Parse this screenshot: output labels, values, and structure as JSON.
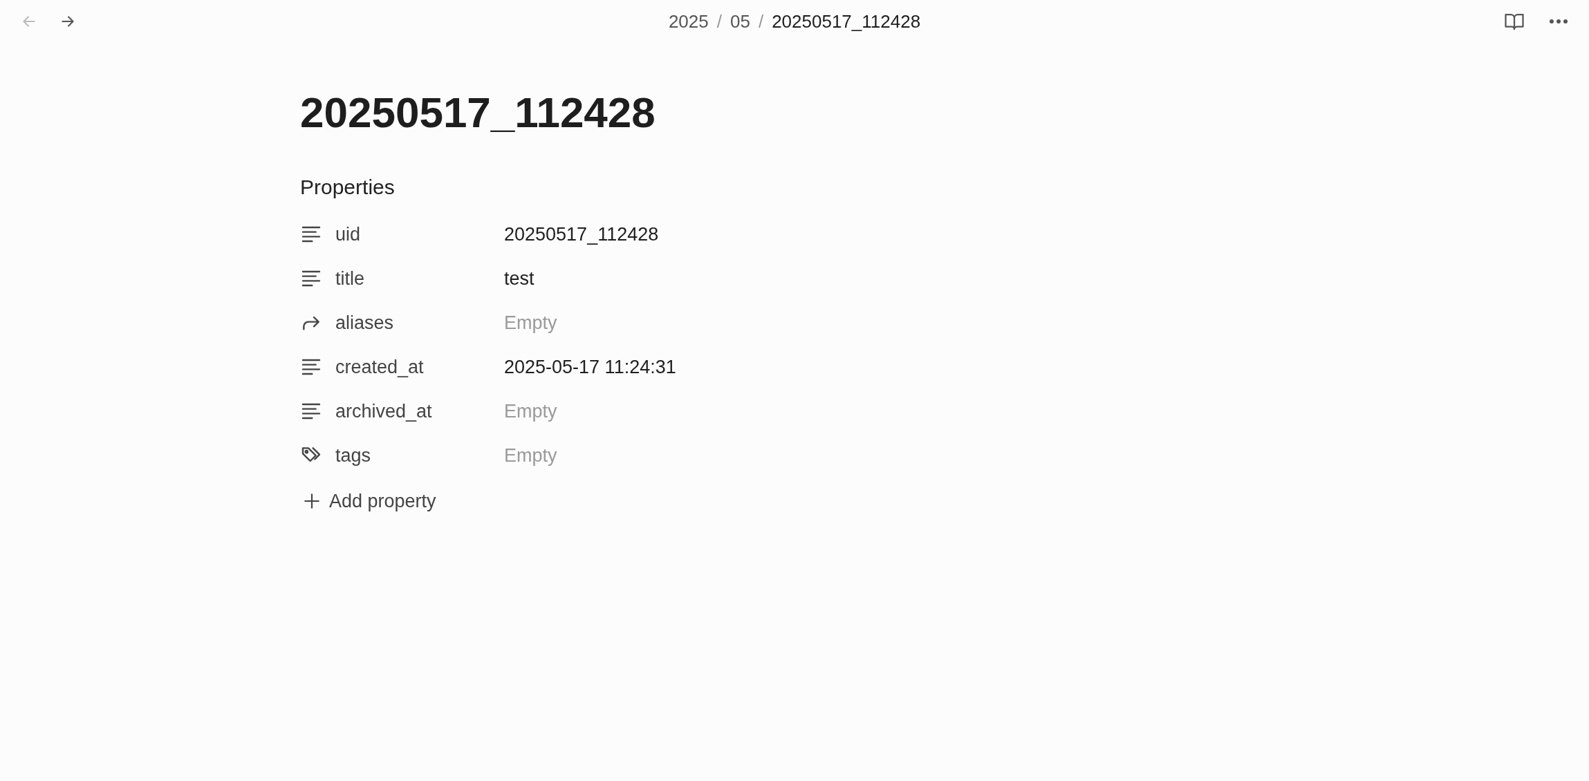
{
  "nav": {
    "back": {
      "disabled": true
    },
    "forward": {
      "disabled": false
    }
  },
  "breadcrumb": [
    {
      "label": "2025",
      "current": false
    },
    {
      "label": "05",
      "current": false
    },
    {
      "label": "20250517_112428",
      "current": true
    }
  ],
  "separator": "/",
  "note": {
    "title": "20250517_112428",
    "properties_heading": "Properties",
    "properties": [
      {
        "kind": "text",
        "name": "uid",
        "value": "20250517_112428"
      },
      {
        "kind": "text",
        "name": "title",
        "value": "test"
      },
      {
        "kind": "link",
        "name": "aliases",
        "placeholder": "Empty"
      },
      {
        "kind": "text",
        "name": "created_at",
        "value": "2025-05-17 11:24:31"
      },
      {
        "kind": "text",
        "name": "archived_at",
        "placeholder": "Empty"
      },
      {
        "kind": "tags",
        "name": "tags",
        "placeholder": "Empty"
      }
    ],
    "add_property": "Add property"
  }
}
